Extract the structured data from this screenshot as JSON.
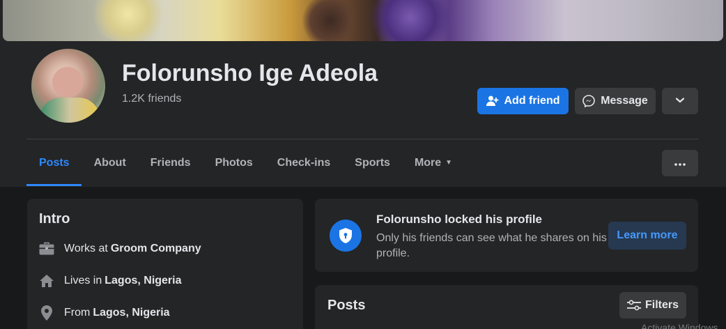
{
  "profile": {
    "name": "Folorunsho Ige Adeola",
    "friends": "1.2K friends"
  },
  "actions": {
    "add_friend": "Add friend",
    "message": "Message"
  },
  "tabs": [
    {
      "label": "Posts",
      "active": true
    },
    {
      "label": "About"
    },
    {
      "label": "Friends"
    },
    {
      "label": "Photos"
    },
    {
      "label": "Check-ins"
    },
    {
      "label": "Sports"
    },
    {
      "label": "More"
    }
  ],
  "intro": {
    "title": "Intro",
    "work_prefix": "Works at",
    "work_value": "Groom Company",
    "lives_prefix": "Lives in",
    "lives_value": "Lagos, Nigeria",
    "from_prefix": "From",
    "from_value": "Lagos, Nigeria"
  },
  "locked": {
    "title": "Folorunsho locked his profile",
    "description": "Only his friends can see what he shares on his profile.",
    "learn_more": "Learn more"
  },
  "posts": {
    "title": "Posts",
    "filters": "Filters"
  },
  "watermark": "Activate Windows",
  "colors": {
    "accent": "#1b74e4",
    "active_tab": "#2d88ff",
    "background": "#18191a",
    "card": "#242526"
  },
  "icons": {
    "add_friend": "person-plus-icon",
    "message": "messenger-icon",
    "dropdown": "chevron-down-icon",
    "ellipsis": "ellipsis-icon",
    "work": "briefcase-icon",
    "home": "home-icon",
    "location": "location-pin-icon",
    "lock": "shield-lock-icon",
    "filters": "sliders-icon"
  }
}
